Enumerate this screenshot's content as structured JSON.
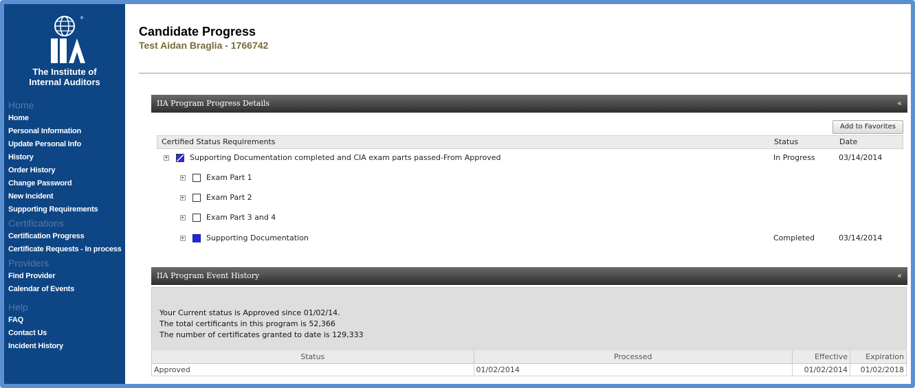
{
  "sidebar": {
    "logo_text_line1": "The Institute of",
    "logo_text_line2": "Internal Auditors",
    "sections": [
      {
        "title": "Home",
        "items": [
          "Home",
          "Personal Information",
          "Update Personal Info",
          "History",
          "Order History",
          "Change Password",
          "New Incident",
          "Supporting Requirements"
        ]
      },
      {
        "title": "Certifications",
        "items": [
          "Certification Progress",
          "Certificate Requests - In process"
        ]
      },
      {
        "title": "Providers",
        "items": [
          "Find Provider",
          "Calendar of Events"
        ]
      },
      {
        "title": "Help",
        "items": [
          "FAQ",
          "Contact Us",
          "Incident History"
        ]
      }
    ]
  },
  "header": {
    "title": "Candidate Progress",
    "subtitle": "Test Aidan Braglia - 1766742"
  },
  "progress_panel": {
    "title": "IIA Program Progress Details",
    "collapse": "«",
    "favorites_button": "Add to Favorites",
    "columns": {
      "requirement": "Certified Status Requirements",
      "status": "Status",
      "date": "Date"
    },
    "root": {
      "label": "Supporting Documentation completed and CIA exam parts passed-From Approved",
      "status": "In Progress",
      "date": "03/14/2014",
      "toggle": "▾"
    },
    "children": [
      {
        "label": "Exam Part 1",
        "status": "",
        "date": "",
        "toggle": "▸"
      },
      {
        "label": "Exam Part 2",
        "status": "",
        "date": "",
        "toggle": "▸"
      },
      {
        "label": "Exam Part 3 and 4",
        "status": "",
        "date": "",
        "toggle": "▸"
      },
      {
        "label": "Supporting Documentation",
        "status": "Completed",
        "date": "03/14/2014",
        "toggle": "▸"
      }
    ]
  },
  "event_panel": {
    "title": "IIA Program Event History",
    "collapse": "«",
    "lines": [
      "Your Current status is Approved since 01/02/14.",
      "The total certificants in this program is 52,366",
      "The number of certificates granted to date is 129,333"
    ],
    "columns": [
      "Status",
      "Processed",
      "Effective",
      "Expiration"
    ],
    "rows": [
      [
        "Approved",
        "01/02/2014",
        "01/02/2014",
        "01/02/2018"
      ]
    ]
  },
  "colors": {
    "sidebar_bg": "#0d4585",
    "frame_border": "#5b8fd0",
    "subtitle": "#7a6a3a",
    "checkbox_fill": "#2222ee"
  }
}
